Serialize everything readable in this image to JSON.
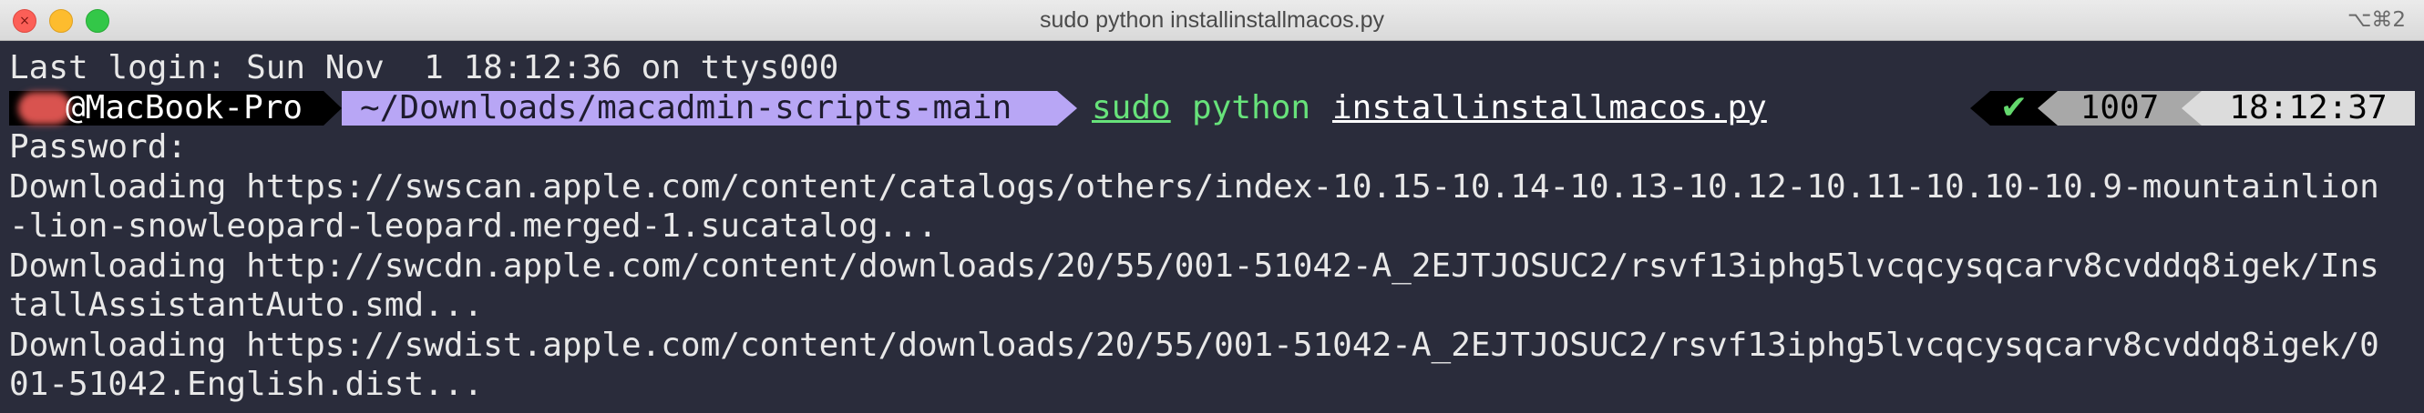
{
  "window": {
    "title": "sudo python installinstallmacos.py",
    "shortcut": "⌥⌘2",
    "close_glyph": "×"
  },
  "terminal": {
    "last_login": "Last login: Sun Nov  1 18:12:36 on ttys000",
    "prompt": {
      "host": "@MacBook-Pro",
      "path": "~/Downloads/macadmin-scripts-main",
      "command_sudo": "sudo",
      "command_python": "python",
      "command_file": "installinstallmacos.py"
    },
    "right_prompt": {
      "status": "✔",
      "history_number": "1007",
      "time": "18:12:37"
    },
    "output": [
      "Password:",
      "Downloading https://swscan.apple.com/content/catalogs/others/index-10.15-10.14-10.13-10.12-10.11-10.10-10.9-mountainlion",
      "-lion-snowleopard-leopard.merged-1.sucatalog...",
      "Downloading http://swcdn.apple.com/content/downloads/20/55/001-51042-A_2EJTJOSUC2/rsvf13iphg5lvcqcysqcarv8cvddq8igek/Ins",
      "tallAssistantAuto.smd...",
      "Downloading https://swdist.apple.com/content/downloads/20/55/001-51042-A_2EJTJOSUC2/rsvf13iphg5lvcqcysqcarv8cvddq8igek/0",
      "01-51042.English.dist..."
    ]
  }
}
